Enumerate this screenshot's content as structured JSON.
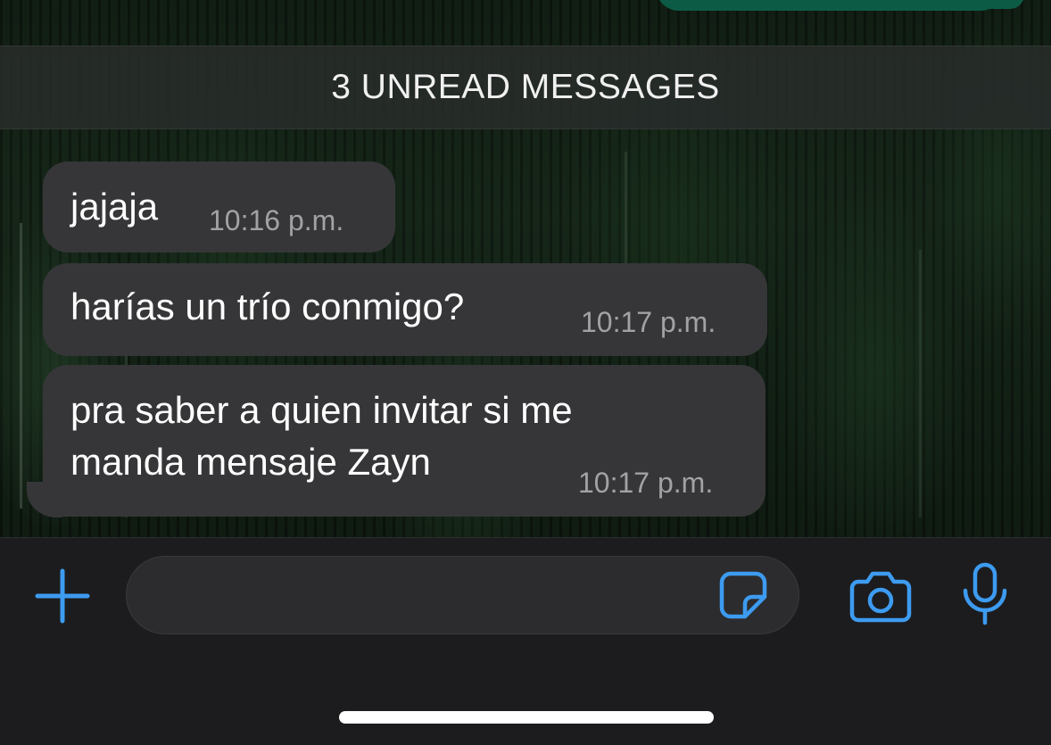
{
  "unread_banner": {
    "text": "3 UNREAD MESSAGES"
  },
  "messages": [
    {
      "text": "jajaja",
      "time": "10:16 p.m.",
      "direction": "incoming"
    },
    {
      "text": "harías un trío conmigo?",
      "time": "10:17 p.m.",
      "direction": "incoming"
    },
    {
      "text": "pra saber a quien invitar si me\nmanda mensaje Zayn",
      "time": "10:17 p.m.",
      "direction": "incoming"
    }
  ],
  "composer": {
    "input_value": "",
    "input_placeholder": "",
    "icons": [
      "plus-icon",
      "sticker-icon",
      "camera-icon",
      "microphone-icon"
    ]
  },
  "colors": {
    "incoming_bubble": "#363638",
    "outgoing_bubble": "#0c5c45",
    "accent": "#3d9bf0",
    "composer_background": "#1c1c1e",
    "timestamp": "#a2a2a6"
  }
}
